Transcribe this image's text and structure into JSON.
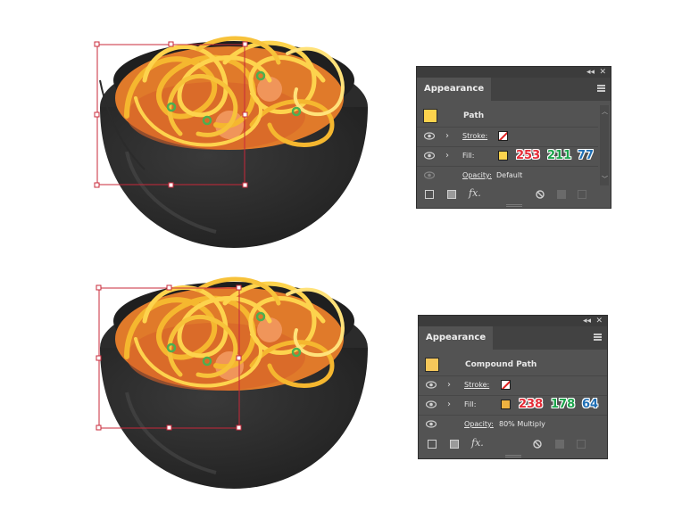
{
  "colors": {
    "panel_bg": "#535353",
    "fill_top": "#FDD34D",
    "fill_bottom": "#EEB240",
    "red": "#e52b36",
    "green": "#1aa34a",
    "blue": "#1f6fb5"
  },
  "panel_top": {
    "tab": "Appearance",
    "collapse_glyph": "◂◂",
    "close_glyph": "✕",
    "object_name": "Path",
    "stroke_label": "Stroke:",
    "fill_label": "Fill:",
    "fill_r": "253",
    "fill_g": "211",
    "fill_b": "77",
    "opacity_label": "Opacity:",
    "opacity_value": "Default",
    "fx_label": "fx."
  },
  "panel_bottom": {
    "tab": "Appearance",
    "collapse_glyph": "◂◂",
    "close_glyph": "✕",
    "object_name": "Compound Path",
    "stroke_label": "Stroke:",
    "fill_label": "Fill:",
    "fill_r": "238",
    "fill_g": "178",
    "fill_b": "64",
    "opacity_label": "Opacity:",
    "opacity_value": "80% Multiply",
    "fx_label": "fx."
  }
}
